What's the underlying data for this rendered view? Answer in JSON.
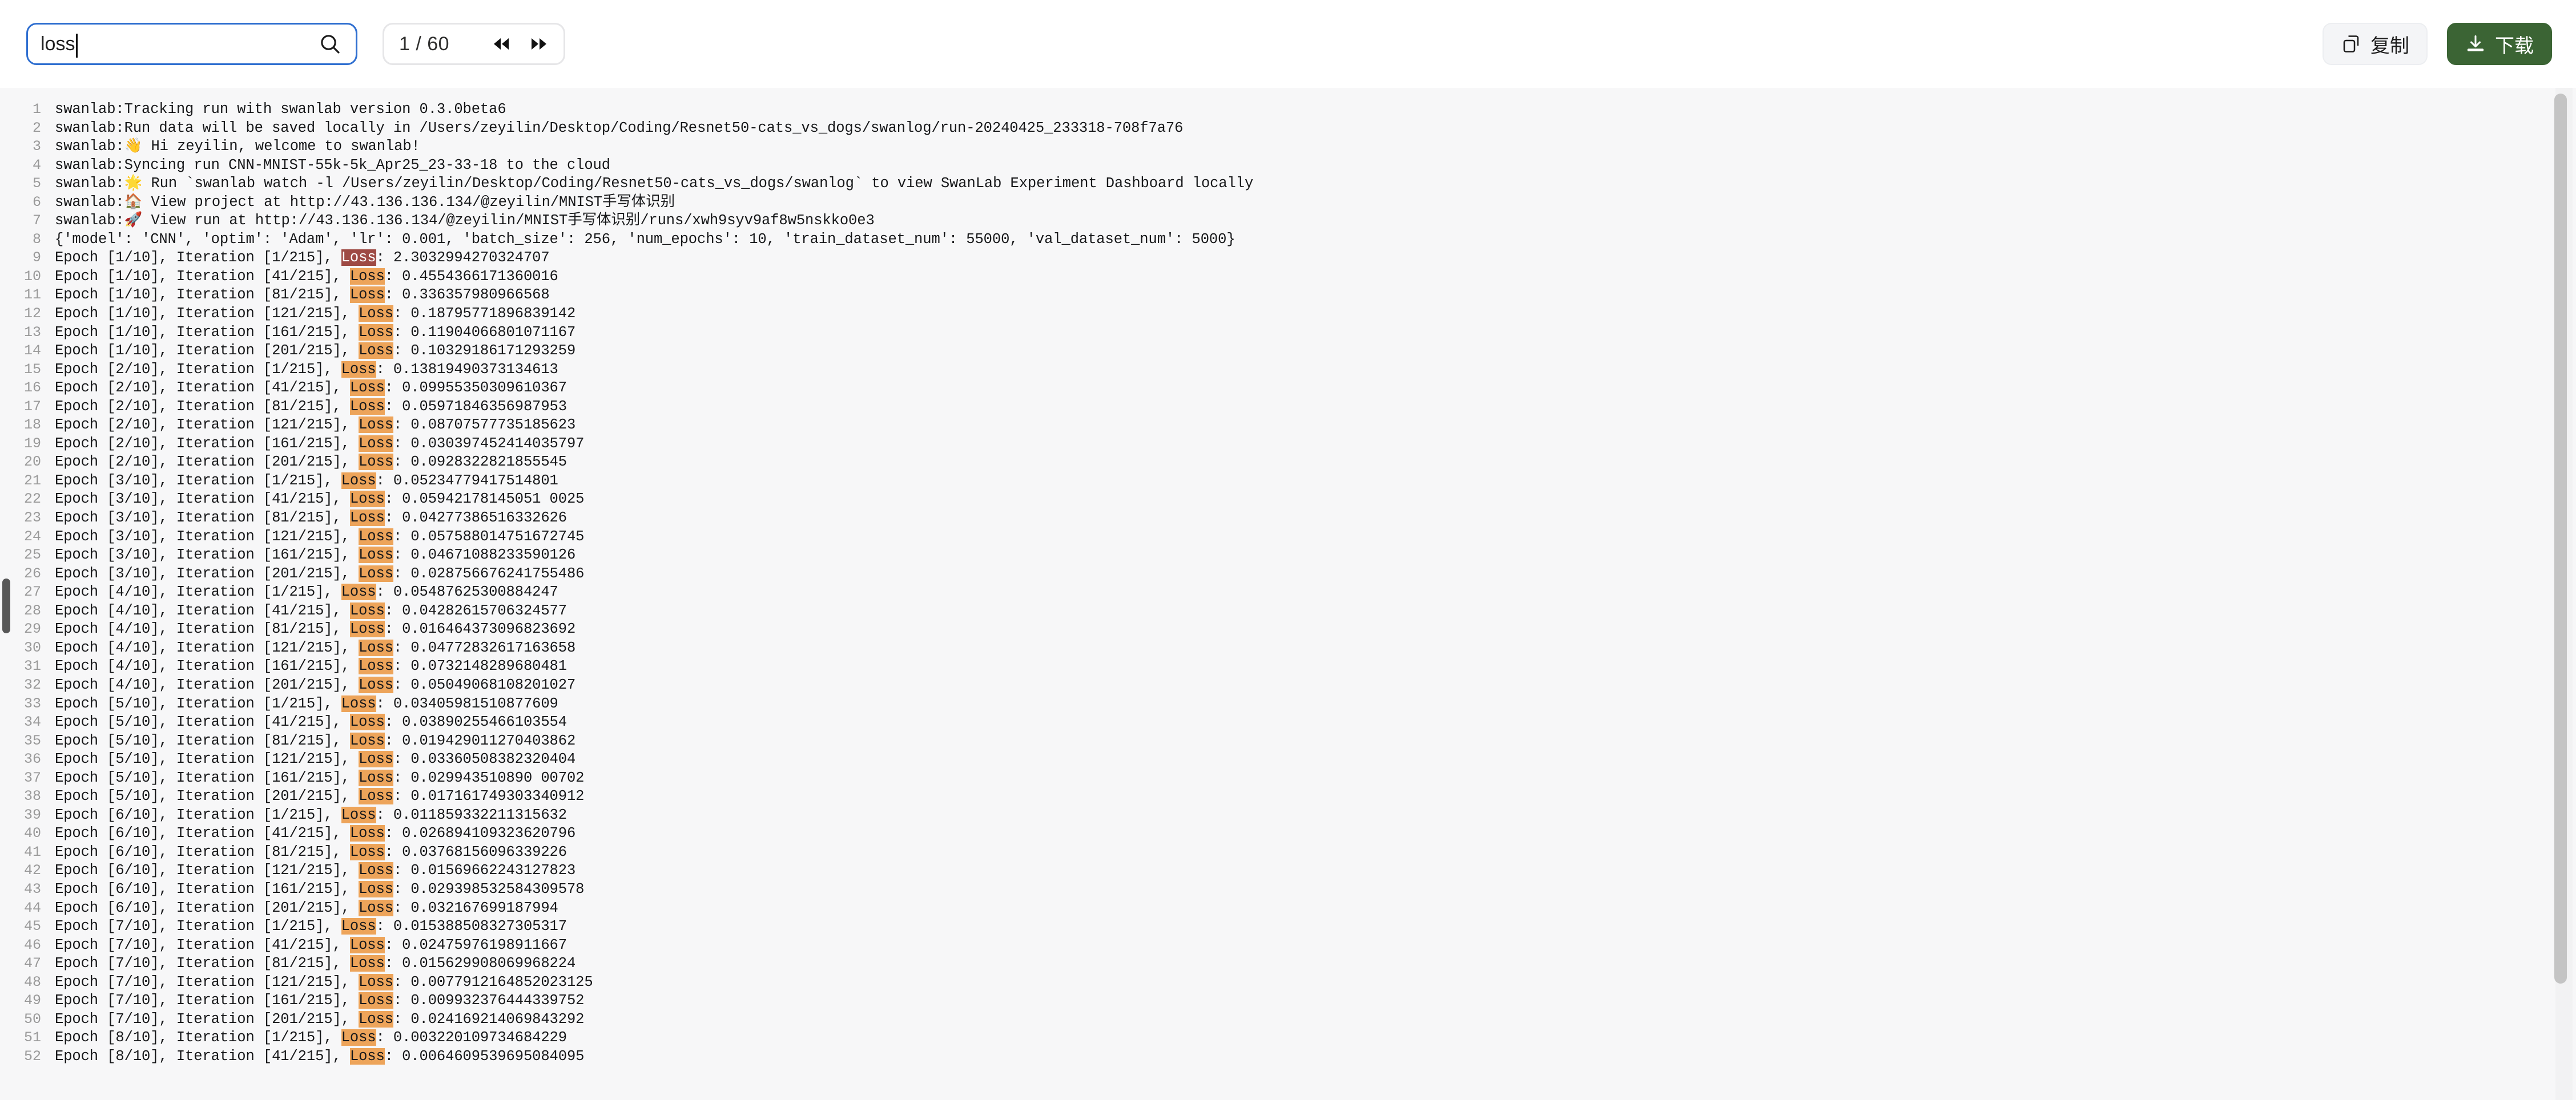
{
  "toolbar": {
    "search": {
      "value": "loss",
      "placeholder": "",
      "icon": "search-icon"
    },
    "pager": {
      "count_label": "1 / 60",
      "current": 1,
      "total": 60,
      "prev_icon": "double-chevron-left-icon",
      "next_icon": "double-chevron-right-icon"
    },
    "copy_button": {
      "label": "复制",
      "icon": "copy-icon"
    },
    "download_button": {
      "label": "下载",
      "icon": "download-icon"
    }
  },
  "colors": {
    "search_border": "#2f6fd0",
    "download_bg": "#3b6434",
    "highlight": "#eda45a",
    "highlight_active": "#9e4a44",
    "log_bg": "#f7f7f8",
    "line_number": "#9a9a9a"
  },
  "log": {
    "highlight_term": "Loss",
    "lines": [
      {
        "n": 1,
        "pre": "swanlab:Tracking run with swanlab version 0.3.0beta6",
        "hl": null,
        "post": ""
      },
      {
        "n": 2,
        "pre": "swanlab:Run data will be saved locally in /Users/zeyilin/Desktop/Coding/Resnet50-cats_vs_dogs/swanlog/run-20240425_233318-708f7a76",
        "hl": null,
        "post": ""
      },
      {
        "n": 3,
        "pre": "swanlab:👋 Hi zeyilin, welcome to swanlab!",
        "hl": null,
        "post": ""
      },
      {
        "n": 4,
        "pre": "swanlab:Syncing run CNN-MNIST-55k-5k_Apr25_23-33-18 to the cloud",
        "hl": null,
        "post": ""
      },
      {
        "n": 5,
        "pre": "swanlab:🌟 Run `swanlab watch -l /Users/zeyilin/Desktop/Coding/Resnet50-cats_vs_dogs/swanlog` to view SwanLab Experiment Dashboard locally",
        "hl": null,
        "post": ""
      },
      {
        "n": 6,
        "pre": "swanlab:🏠 View project at http://43.136.136.134/@zeyilin/MNIST手写体识别",
        "hl": null,
        "post": ""
      },
      {
        "n": 7,
        "pre": "swanlab:🚀 View run at http://43.136.136.134/@zeyilin/MNIST手写体识别/runs/xwh9syv9af8w5nskko0e3",
        "hl": null,
        "post": ""
      },
      {
        "n": 8,
        "pre": "{'model': 'CNN', 'optim': 'Adam', 'lr': 0.001, 'batch_size': 256, 'num_epochs': 10, 'train_dataset_num': 55000, 'val_dataset_num': 5000}",
        "hl": null,
        "post": ""
      },
      {
        "n": 9,
        "pre": "Epoch [1/10], Iteration [1/215], ",
        "hl": "Loss",
        "hl_active": true,
        "post": ": 2.3032994270324707"
      },
      {
        "n": 10,
        "pre": "Epoch [1/10], Iteration [41/215], ",
        "hl": "Loss",
        "post": ": 0.4554366171360016"
      },
      {
        "n": 11,
        "pre": "Epoch [1/10], Iteration [81/215], ",
        "hl": "Loss",
        "post": ": 0.336357980966568"
      },
      {
        "n": 12,
        "pre": "Epoch [1/10], Iteration [121/215], ",
        "hl": "Loss",
        "post": ": 0.18795771896839142"
      },
      {
        "n": 13,
        "pre": "Epoch [1/10], Iteration [161/215], ",
        "hl": "Loss",
        "post": ": 0.11904066801071167"
      },
      {
        "n": 14,
        "pre": "Epoch [1/10], Iteration [201/215], ",
        "hl": "Loss",
        "post": ": 0.10329186171293259"
      },
      {
        "n": 15,
        "pre": "Epoch [2/10], Iteration [1/215], ",
        "hl": "Loss",
        "post": ": 0.13819490373134613"
      },
      {
        "n": 16,
        "pre": "Epoch [2/10], Iteration [41/215], ",
        "hl": "Loss",
        "post": ": 0.09955350309610367"
      },
      {
        "n": 17,
        "pre": "Epoch [2/10], Iteration [81/215], ",
        "hl": "Loss",
        "post": ": 0.05971846356987953"
      },
      {
        "n": 18,
        "pre": "Epoch [2/10], Iteration [121/215], ",
        "hl": "Loss",
        "post": ": 0.08707577735185623"
      },
      {
        "n": 19,
        "pre": "Epoch [2/10], Iteration [161/215], ",
        "hl": "Loss",
        "post": ": 0.030397452414035797"
      },
      {
        "n": 20,
        "pre": "Epoch [2/10], Iteration [201/215], ",
        "hl": "Loss",
        "post": ": 0.0928322821855545"
      },
      {
        "n": 21,
        "pre": "Epoch [3/10], Iteration [1/215], ",
        "hl": "Loss",
        "post": ": 0.05234779417514801"
      },
      {
        "n": 22,
        "pre": "Epoch [3/10], Iteration [41/215], ",
        "hl": "Loss",
        "post": ": 0.05942178145051 0025"
      },
      {
        "n": 23,
        "pre": "Epoch [3/10], Iteration [81/215], ",
        "hl": "Loss",
        "post": ": 0.04277386516332626"
      },
      {
        "n": 24,
        "pre": "Epoch [3/10], Iteration [121/215], ",
        "hl": "Loss",
        "post": ": 0.057588014751672745"
      },
      {
        "n": 25,
        "pre": "Epoch [3/10], Iteration [161/215], ",
        "hl": "Loss",
        "post": ": 0.04671088233590126"
      },
      {
        "n": 26,
        "pre": "Epoch [3/10], Iteration [201/215], ",
        "hl": "Loss",
        "post": ": 0.028756676241755486"
      },
      {
        "n": 27,
        "pre": "Epoch [4/10], Iteration [1/215], ",
        "hl": "Loss",
        "post": ": 0.05487625300884247"
      },
      {
        "n": 28,
        "pre": "Epoch [4/10], Iteration [41/215], ",
        "hl": "Loss",
        "post": ": 0.04282615706324577"
      },
      {
        "n": 29,
        "pre": "Epoch [4/10], Iteration [81/215], ",
        "hl": "Loss",
        "post": ": 0.016464373096823692"
      },
      {
        "n": 30,
        "pre": "Epoch [4/10], Iteration [121/215], ",
        "hl": "Loss",
        "post": ": 0.04772832617163658"
      },
      {
        "n": 31,
        "pre": "Epoch [4/10], Iteration [161/215], ",
        "hl": "Loss",
        "post": ": 0.0732148289680481"
      },
      {
        "n": 32,
        "pre": "Epoch [4/10], Iteration [201/215], ",
        "hl": "Loss",
        "post": ": 0.05049068108201027"
      },
      {
        "n": 33,
        "pre": "Epoch [5/10], Iteration [1/215], ",
        "hl": "Loss",
        "post": ": 0.03405981510877609"
      },
      {
        "n": 34,
        "pre": "Epoch [5/10], Iteration [41/215], ",
        "hl": "Loss",
        "post": ": 0.03890255466103554"
      },
      {
        "n": 35,
        "pre": "Epoch [5/10], Iteration [81/215], ",
        "hl": "Loss",
        "post": ": 0.019429011270403862"
      },
      {
        "n": 36,
        "pre": "Epoch [5/10], Iteration [121/215], ",
        "hl": "Loss",
        "post": ": 0.03360508382320404"
      },
      {
        "n": 37,
        "pre": "Epoch [5/10], Iteration [161/215], ",
        "hl": "Loss",
        "post": ": 0.029943510890 00702"
      },
      {
        "n": 38,
        "pre": "Epoch [5/10], Iteration [201/215], ",
        "hl": "Loss",
        "post": ": 0.017161749303340912"
      },
      {
        "n": 39,
        "pre": "Epoch [6/10], Iteration [1/215], ",
        "hl": "Loss",
        "post": ": 0.011859332211315632"
      },
      {
        "n": 40,
        "pre": "Epoch [6/10], Iteration [41/215], ",
        "hl": "Loss",
        "post": ": 0.026894109323620796"
      },
      {
        "n": 41,
        "pre": "Epoch [6/10], Iteration [81/215], ",
        "hl": "Loss",
        "post": ": 0.03768156096339226"
      },
      {
        "n": 42,
        "pre": "Epoch [6/10], Iteration [121/215], ",
        "hl": "Loss",
        "post": ": 0.01569662243127823"
      },
      {
        "n": 43,
        "pre": "Epoch [6/10], Iteration [161/215], ",
        "hl": "Loss",
        "post": ": 0.029398532584309578"
      },
      {
        "n": 44,
        "pre": "Epoch [6/10], Iteration [201/215], ",
        "hl": "Loss",
        "post": ": 0.032167699187994"
      },
      {
        "n": 45,
        "pre": "Epoch [7/10], Iteration [1/215], ",
        "hl": "Loss",
        "post": ": 0.015388508327305317"
      },
      {
        "n": 46,
        "pre": "Epoch [7/10], Iteration [41/215], ",
        "hl": "Loss",
        "post": ": 0.02475976198911667"
      },
      {
        "n": 47,
        "pre": "Epoch [7/10], Iteration [81/215], ",
        "hl": "Loss",
        "post": ": 0.015629908069968224"
      },
      {
        "n": 48,
        "pre": "Epoch [7/10], Iteration [121/215], ",
        "hl": "Loss",
        "post": ": 0.0077912164852023125"
      },
      {
        "n": 49,
        "pre": "Epoch [7/10], Iteration [161/215], ",
        "hl": "Loss",
        "post": ": 0.009932376444339752"
      },
      {
        "n": 50,
        "pre": "Epoch [7/10], Iteration [201/215], ",
        "hl": "Loss",
        "post": ": 0.024169214069843292"
      },
      {
        "n": 51,
        "pre": "Epoch [8/10], Iteration [1/215], ",
        "hl": "Loss",
        "post": ": 0.003220109734684229"
      },
      {
        "n": 52,
        "pre": "Epoch [8/10], Iteration [41/215], ",
        "hl": "Loss",
        "post": ": 0.0064609539695084095"
      }
    ]
  }
}
